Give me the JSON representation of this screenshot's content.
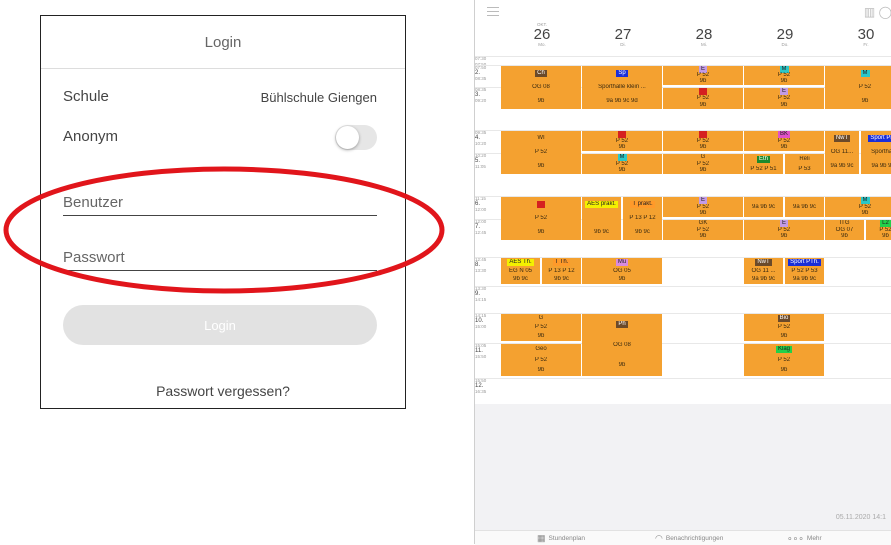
{
  "login": {
    "title": "Login",
    "school_label": "Schule",
    "school_value": "Bühlschule Giengen",
    "anonym_label": "Anonym",
    "user_placeholder": "Benutzer",
    "password_placeholder": "Passwort",
    "login_button": "Login",
    "forgot_password": "Passwort vergessen?"
  },
  "colors": {
    "accent": "#f4a130",
    "ellipse": "#e1151b",
    "empty_area": "#f2f2f4"
  },
  "timetable": {
    "icons": [
      "menu-icon",
      "calendar-grid-icon",
      "chat-icon"
    ],
    "days": [
      {
        "month": "OKT.",
        "num": "26",
        "name": "Mo."
      },
      {
        "month": "",
        "num": "27",
        "name": "Di."
      },
      {
        "month": "",
        "num": "28",
        "name": "Mi."
      },
      {
        "month": "",
        "num": "29",
        "name": "Do."
      },
      {
        "month": "",
        "num": "30",
        "name": "Fr."
      }
    ],
    "periods": [
      {
        "start": "07:30",
        "mid": "07:50",
        "end": "",
        "no": ""
      },
      {
        "start": "07:50",
        "mid": "",
        "end": "08:35",
        "no": "2."
      },
      {
        "start": "08:35",
        "mid": "",
        "end": "09:20",
        "no": "3."
      },
      {
        "start": "09:35",
        "mid": "",
        "end": "10:20",
        "no": "4."
      },
      {
        "start": "10:20",
        "mid": "",
        "end": "11:05",
        "no": "5."
      },
      {
        "start": "11:15",
        "mid": "",
        "end": "12:00",
        "no": "6."
      },
      {
        "start": "12:00",
        "mid": "",
        "end": "12:45",
        "no": "7."
      },
      {
        "start": "12:45",
        "mid": "",
        "end": "13:30",
        "no": "8."
      },
      {
        "start": "13:30",
        "mid": "",
        "end": "14:15",
        "no": "9."
      },
      {
        "start": "14:15",
        "mid": "",
        "end": "15:00",
        "no": "10."
      },
      {
        "start": "15:05",
        "mid": "",
        "end": "15:50",
        "no": "11."
      },
      {
        "start": "15:50",
        "mid": "",
        "end": "16:35",
        "no": "12."
      }
    ],
    "lessons": {
      "mo_a": {
        "subj": "Ch",
        "subjc": "#6b4a2a",
        "room": "OG 08",
        "cls": "9b"
      },
      "mo_b": {
        "subj": "WI",
        "room": "P 52",
        "cls": "9b"
      },
      "mo_c": {
        "subj": "",
        "subjc": "#d52020",
        "room": "P 52",
        "cls": "9b"
      },
      "mo_d1": {
        "subj": "AES Th.",
        "subjc": "#f4f000",
        "room": "EG N 05",
        "cls": "9b 9c"
      },
      "mo_d2": {
        "subj": "T Th.",
        "subjc": "#ff9a2a",
        "room": "P 13 P 12",
        "cls": "9b 9c"
      },
      "mo_e": {
        "subj": "G",
        "room": "P 52",
        "cls": "9b"
      },
      "mo_f": {
        "subj": "Geo",
        "room": "P 52",
        "cls": "9b"
      },
      "di_a": {
        "subj": "Sp",
        "subjc": "#1a2ed8",
        "room": "Sporthalle klein ...",
        "cls": "9a 9b 9c 9d"
      },
      "di_b1": {
        "subj": "",
        "subjc": "#d52020",
        "room": "P 52",
        "cls": "9b"
      },
      "di_b2": {
        "subj": "M",
        "subjc": "#2bc7c7",
        "room": "P 52",
        "cls": "9b"
      },
      "di_c1": {
        "subj": "AES prakt.",
        "subjc": "#f4f000",
        "cls": "9b 9c"
      },
      "di_c2": {
        "subj": "T prakt.",
        "subjc": "#ff9a2a",
        "room": "P 13 P 12",
        "cls": "9b 9c"
      },
      "di_d": {
        "subj": "Mu",
        "subjc": "#d88ae0",
        "room": "OG 05",
        "cls": "9b"
      },
      "di_e": {
        "subj": "Ph",
        "subjc": "#6b4a2a",
        "room": "OG 08",
        "cls": "9b"
      },
      "mi_a1": {
        "subj": "E",
        "subjc": "#c39be6",
        "room": "P 52",
        "cls": "9b"
      },
      "mi_a2": {
        "subj": "",
        "subjc": "#d52020",
        "room": "P 52",
        "cls": "9b"
      },
      "mi_b1": {
        "subj": "",
        "subjc": "#d52020",
        "room": "P 52",
        "cls": "9b"
      },
      "mi_b2": {
        "subj": "G",
        "room": "P 52",
        "cls": "9b"
      },
      "mi_c1": {
        "subj": "E",
        "subjc": "#c39be6",
        "room": "P 52",
        "cls": "9b"
      },
      "mi_c2": {
        "subj": "GK",
        "room": "P 52",
        "cls": "9b"
      },
      "do_a1": {
        "subj": "M",
        "subjc": "#2bc7c7",
        "room": "P 52",
        "cls": "9b"
      },
      "do_a2": {
        "subj": "E",
        "subjc": "#c39be6",
        "room": "P 52",
        "cls": "9b"
      },
      "do_b1": {
        "subj": "BK",
        "subjc": "#e050c8",
        "room": "P 52",
        "cls": "9b"
      },
      "do_b2a": {
        "subj": "Eth",
        "subjc": "#1c8a2c",
        "room": "P 52 P 51"
      },
      "do_b2b": {
        "subj": "Reli",
        "room": "P 53"
      },
      "do_c1": {
        "cls": "9a 9b 9c"
      },
      "do_c1b": {
        "cls": "9a 9b 9c"
      },
      "do_c2": {
        "subj": "E",
        "subjc": "#c39be6",
        "room": "P 52",
        "cls": "9b"
      },
      "do_d1": {
        "subj": "NwT",
        "subjc": "#6b4a2a",
        "room": "OG 11 ...",
        "cls": "9a 9b 9c"
      },
      "do_d2": {
        "subj": "Sport PTh.",
        "subjc": "#1a2ed8",
        "room": "P 52 P 53",
        "cls": "9a 9b 9c"
      },
      "do_e": {
        "subj": "Bio",
        "subjc": "#6b4a2a",
        "room": "P 52",
        "cls": "9b"
      },
      "do_f": {
        "subj": "Klag",
        "subjc": "#22d04a",
        "room": "P 52",
        "cls": "9b"
      },
      "fr_a": {
        "subj": "M",
        "subjc": "#2bc7c7",
        "room": "P 52",
        "cls": "9b"
      },
      "fr_b1": {
        "subj": "NwT",
        "subjc": "#6b4a2a",
        "room": "OG 11...",
        "cls": "9a 9b 9c"
      },
      "fr_b2": {
        "subj": "Sport Pra",
        "subjc": "#1a2ed8",
        "room": "Sporthall",
        "cls": "9a 9b 9c"
      },
      "fr_c1": {
        "subj": "M",
        "subjc": "#2bc7c7",
        "room": "P 52",
        "cls": "9b"
      },
      "fr_c2a": {
        "subj": "ITG",
        "room": "OG 07",
        "cls": "9b"
      },
      "fr_c2b": {
        "subj": "L2",
        "subjc": "#22d04a",
        "room": "P 52",
        "cls": "9b"
      }
    },
    "stamp": "05.11.2020 14:1",
    "tabs": [
      {
        "icon": "calendar-icon",
        "label": "Stundenplan"
      },
      {
        "icon": "bell-icon",
        "label": "Benachrichtigungen"
      },
      {
        "icon": "more-dots-icon",
        "label": "Mehr"
      }
    ]
  }
}
